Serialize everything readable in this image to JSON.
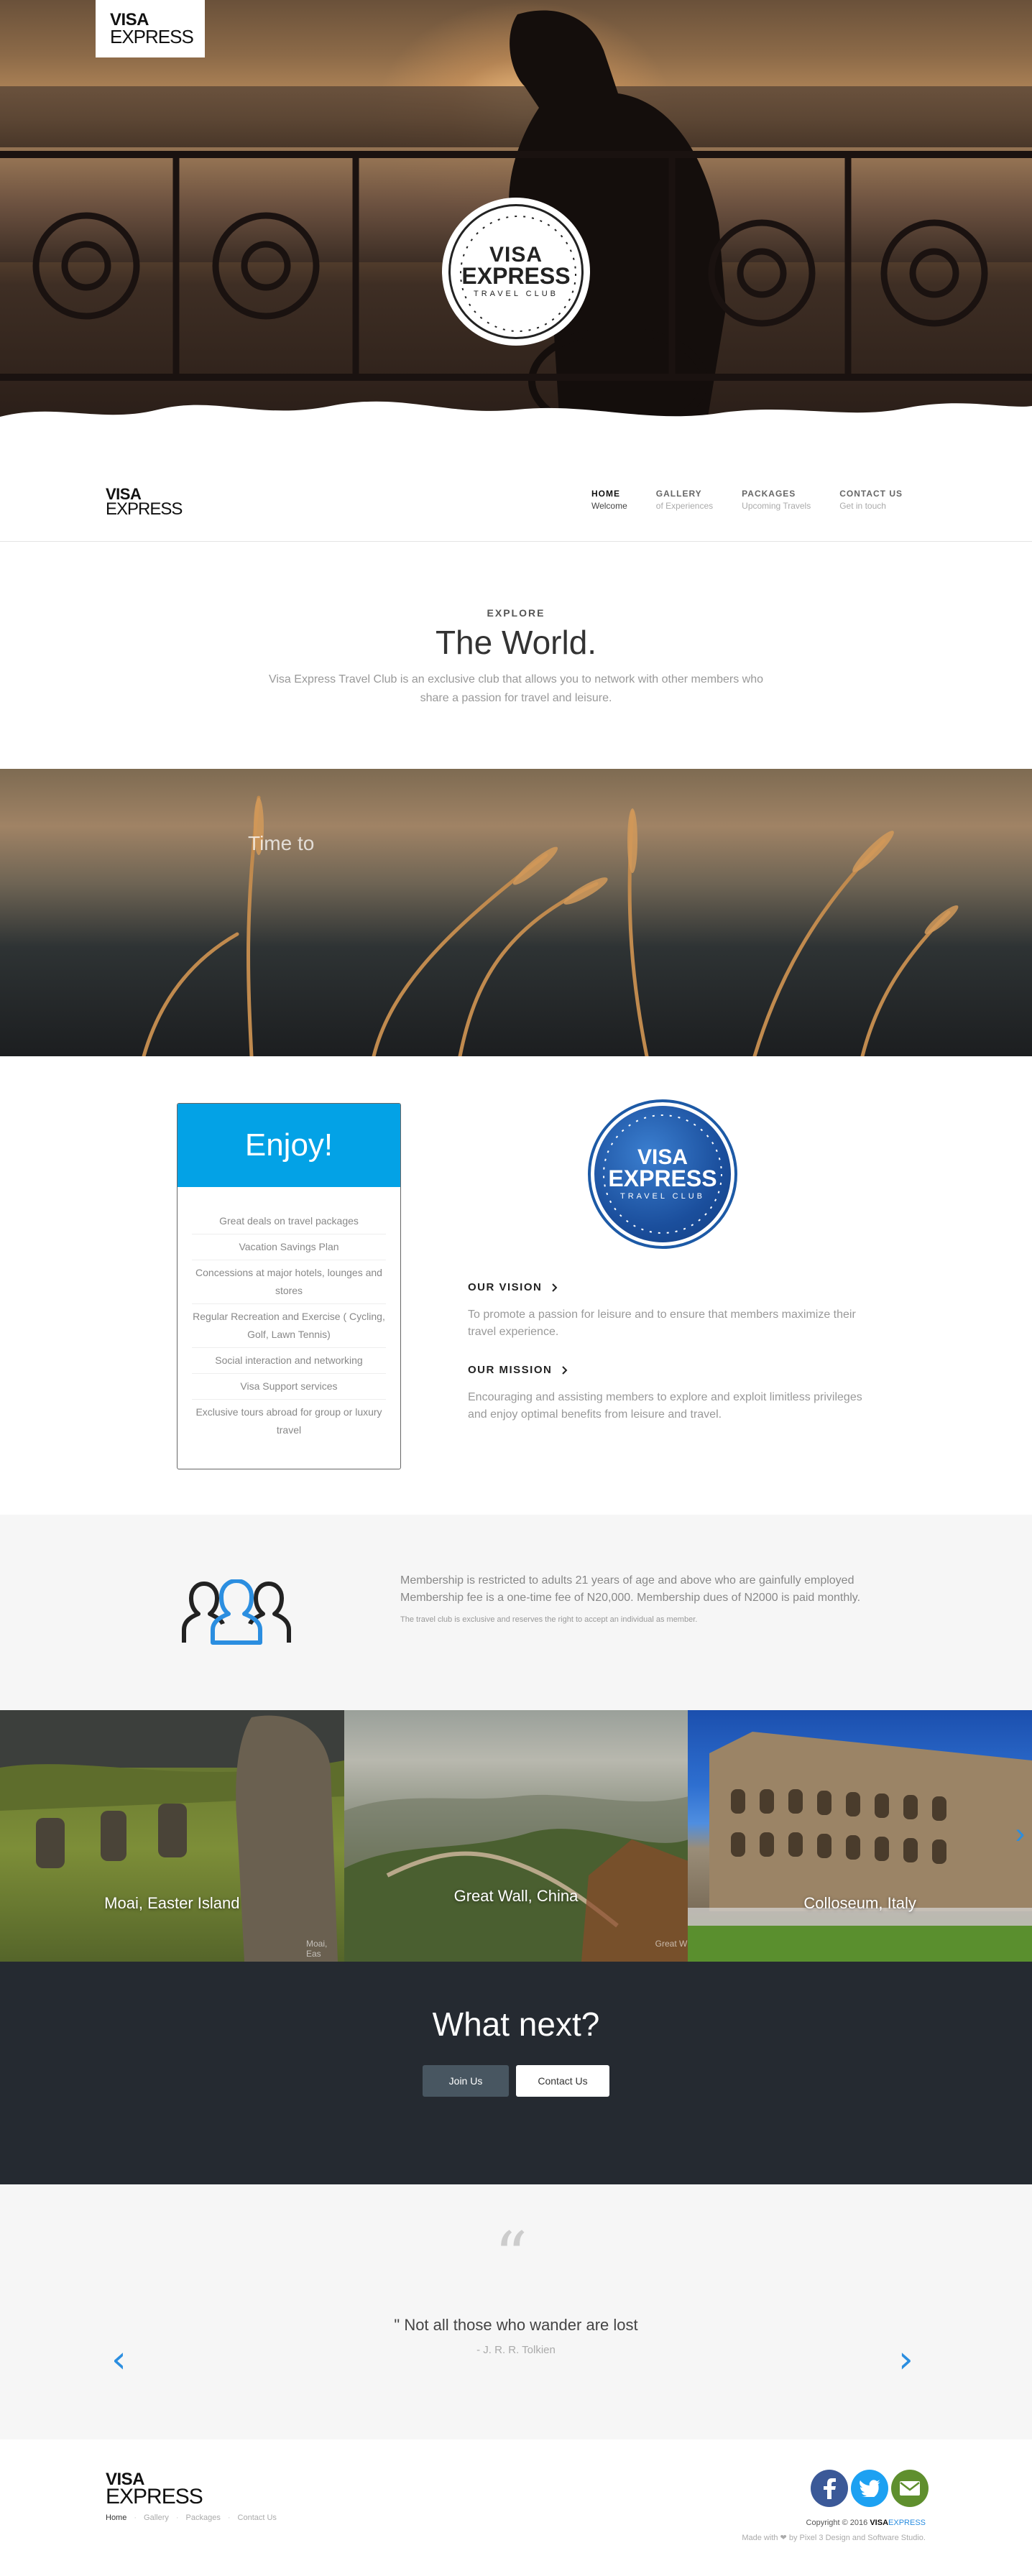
{
  "brand": {
    "word1": "VISA",
    "word2": "EXPRESS"
  },
  "hero_seal": {
    "line1": "VISA",
    "line2": "EXPRESS",
    "line3": "TRAVEL CLUB"
  },
  "nav": {
    "items": [
      {
        "title": "HOME",
        "sub": "Welcome",
        "active": true
      },
      {
        "title": "GALLERY",
        "sub": "of Experiences",
        "active": false
      },
      {
        "title": "PACKAGES",
        "sub": "Upcoming Travels",
        "active": false
      },
      {
        "title": "CONTACT US",
        "sub": "Get in touch",
        "active": false
      }
    ]
  },
  "explore": {
    "kicker": "EXPLORE",
    "title": "The World.",
    "text": "Visa Express Travel Club is an exclusive club that allows you to network with other members who share a passion for travel and leisure."
  },
  "banner": {
    "text": "Time to"
  },
  "enjoy": {
    "title": "Enjoy!",
    "items": [
      "Great deals on travel packages",
      "Vacation Savings Plan",
      "Concessions at major hotels, lounges and stores",
      "Regular Recreation and Exercise ( Cycling, Golf, Lawn Tennis)",
      "Social interaction and networking",
      "Visa Support services",
      "Exclusive tours abroad for group or luxury travel"
    ]
  },
  "blue_seal": {
    "line1": "VISA",
    "line2": "EXPRESS",
    "line3": "TRAVEL CLUB"
  },
  "vision": {
    "title": "OUR VISION",
    "text": "To promote a passion for leisure and to ensure that members maximize their travel experience."
  },
  "mission": {
    "title": "OUR MISSION",
    "text": "Encouraging and assisting members to explore and exploit limitless privileges and enjoy optimal benefits from leisure and travel."
  },
  "membership": {
    "text": "Membership is restricted to adults 21 years of age and above who are gainfully employed Membership fee is a one-time fee of N20,000. Membership dues of N2000 is paid monthly.",
    "note": "The travel club is exclusive and reserves the right to accept an individual as member."
  },
  "gallery": {
    "items": [
      {
        "caption": "Moai, Easter Island",
        "small": "Moai, Eas"
      },
      {
        "caption": "Great Wall, China",
        "small": "Great W"
      },
      {
        "caption": "Colloseum, Italy",
        "small": ""
      }
    ],
    "next_arrow": "›"
  },
  "whatnext": {
    "title": "What next?",
    "join": "Join Us",
    "contact": "Contact Us"
  },
  "quote": {
    "mark": "“",
    "text": "\" Not all those who wander are lost",
    "author": "- J. R. R. Tolkien",
    "prev": "‹",
    "next": "›"
  },
  "footer": {
    "links": [
      "Home",
      "Gallery",
      "Packages",
      "Contact Us"
    ],
    "copyright_prefix": "Copyright © 2016 ",
    "copyright_brand1": "VISA",
    "copyright_brand2": "EXPRESS",
    "made": "Made with ❤ by Pixel 3 Design and Software Studio."
  },
  "colors": {
    "accent": "#03a2e6",
    "dark_section": "#252a31",
    "link_blue": "#2b8ee0"
  }
}
